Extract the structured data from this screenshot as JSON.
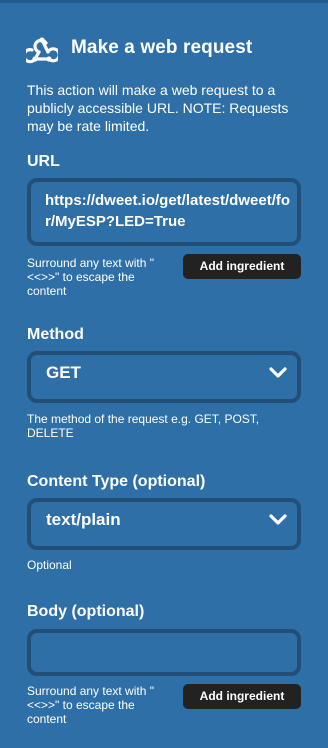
{
  "header": {
    "title": "Make a web request",
    "icon": "webhooks-icon"
  },
  "description": "This action will make a web request to a publicly accessible URL. NOTE: Requests may be rate limited.",
  "url": {
    "label": "URL",
    "value": "https://dweet.io/get/latest/dweet/for/MyESP?LED=True",
    "helper": "Surround any text with \"<<>>\" to escape the content",
    "ingredient_button": "Add ingredient"
  },
  "method": {
    "label": "Method",
    "value": "GET",
    "helper": "The method of the request e.g. GET, POST, DELETE"
  },
  "content_type": {
    "label": "Content Type (optional)",
    "value": "text/plain",
    "helper": "Optional"
  },
  "body": {
    "label": "Body (optional)",
    "value": "",
    "helper": "Surround any text with \"<<>>\" to escape the content",
    "ingredient_button": "Add ingredient"
  },
  "colors": {
    "background": "#2e6fa7",
    "field_border": "#234e78",
    "button_bg": "#222222"
  }
}
